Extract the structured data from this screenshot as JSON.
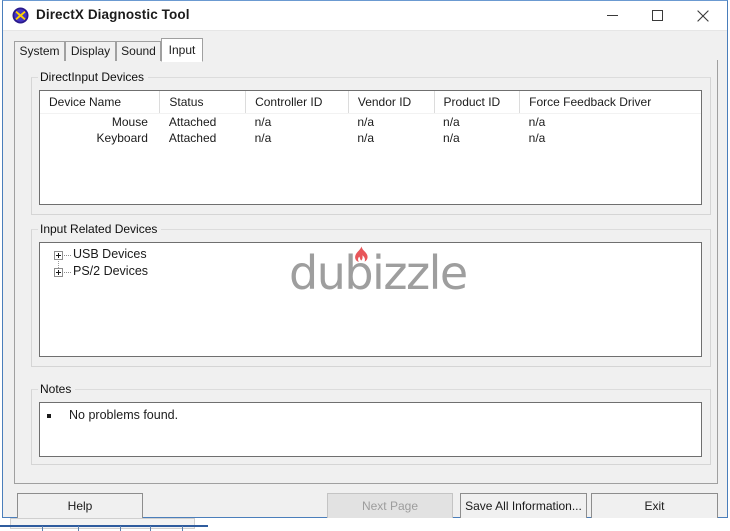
{
  "window": {
    "title": "DirectX Diagnostic Tool",
    "icon": "directx-icon",
    "controls": {
      "minimize": "minimize-icon",
      "maximize": "maximize-icon",
      "close": "close-icon"
    }
  },
  "tabs": [
    {
      "label": "System",
      "active": false
    },
    {
      "label": "Display",
      "active": false
    },
    {
      "label": "Sound",
      "active": false
    },
    {
      "label": "Input",
      "active": true
    }
  ],
  "direct_input_devices": {
    "legend": "DirectInput Devices",
    "columns": [
      "Device Name",
      "Status",
      "Controller ID",
      "Vendor ID",
      "Product ID",
      "Force Feedback Driver"
    ],
    "rows": [
      [
        "Mouse",
        "Attached",
        "n/a",
        "n/a",
        "n/a",
        "n/a"
      ],
      [
        "Keyboard",
        "Attached",
        "n/a",
        "n/a",
        "n/a",
        "n/a"
      ]
    ]
  },
  "input_related_devices": {
    "legend": "Input Related Devices",
    "items": [
      {
        "label": "USB Devices",
        "expanded": false
      },
      {
        "label": "PS/2 Devices",
        "expanded": false
      }
    ]
  },
  "notes": {
    "legend": "Notes",
    "lines": [
      "No problems found."
    ]
  },
  "buttons": {
    "help": "Help",
    "next_page": "Next Page",
    "save_all": "Save All Information...",
    "exit": "Exit"
  },
  "watermark": {
    "text": "dubizzle",
    "color": "#9e9e9e",
    "flame_color": "#e8565a"
  },
  "colors": {
    "window_border": "#4a7ebb",
    "dialog_background": "#f0f0f0",
    "pane_background": "#ffffff",
    "text": "#1b1b1b",
    "disabled_text": "#9d9d9d"
  }
}
